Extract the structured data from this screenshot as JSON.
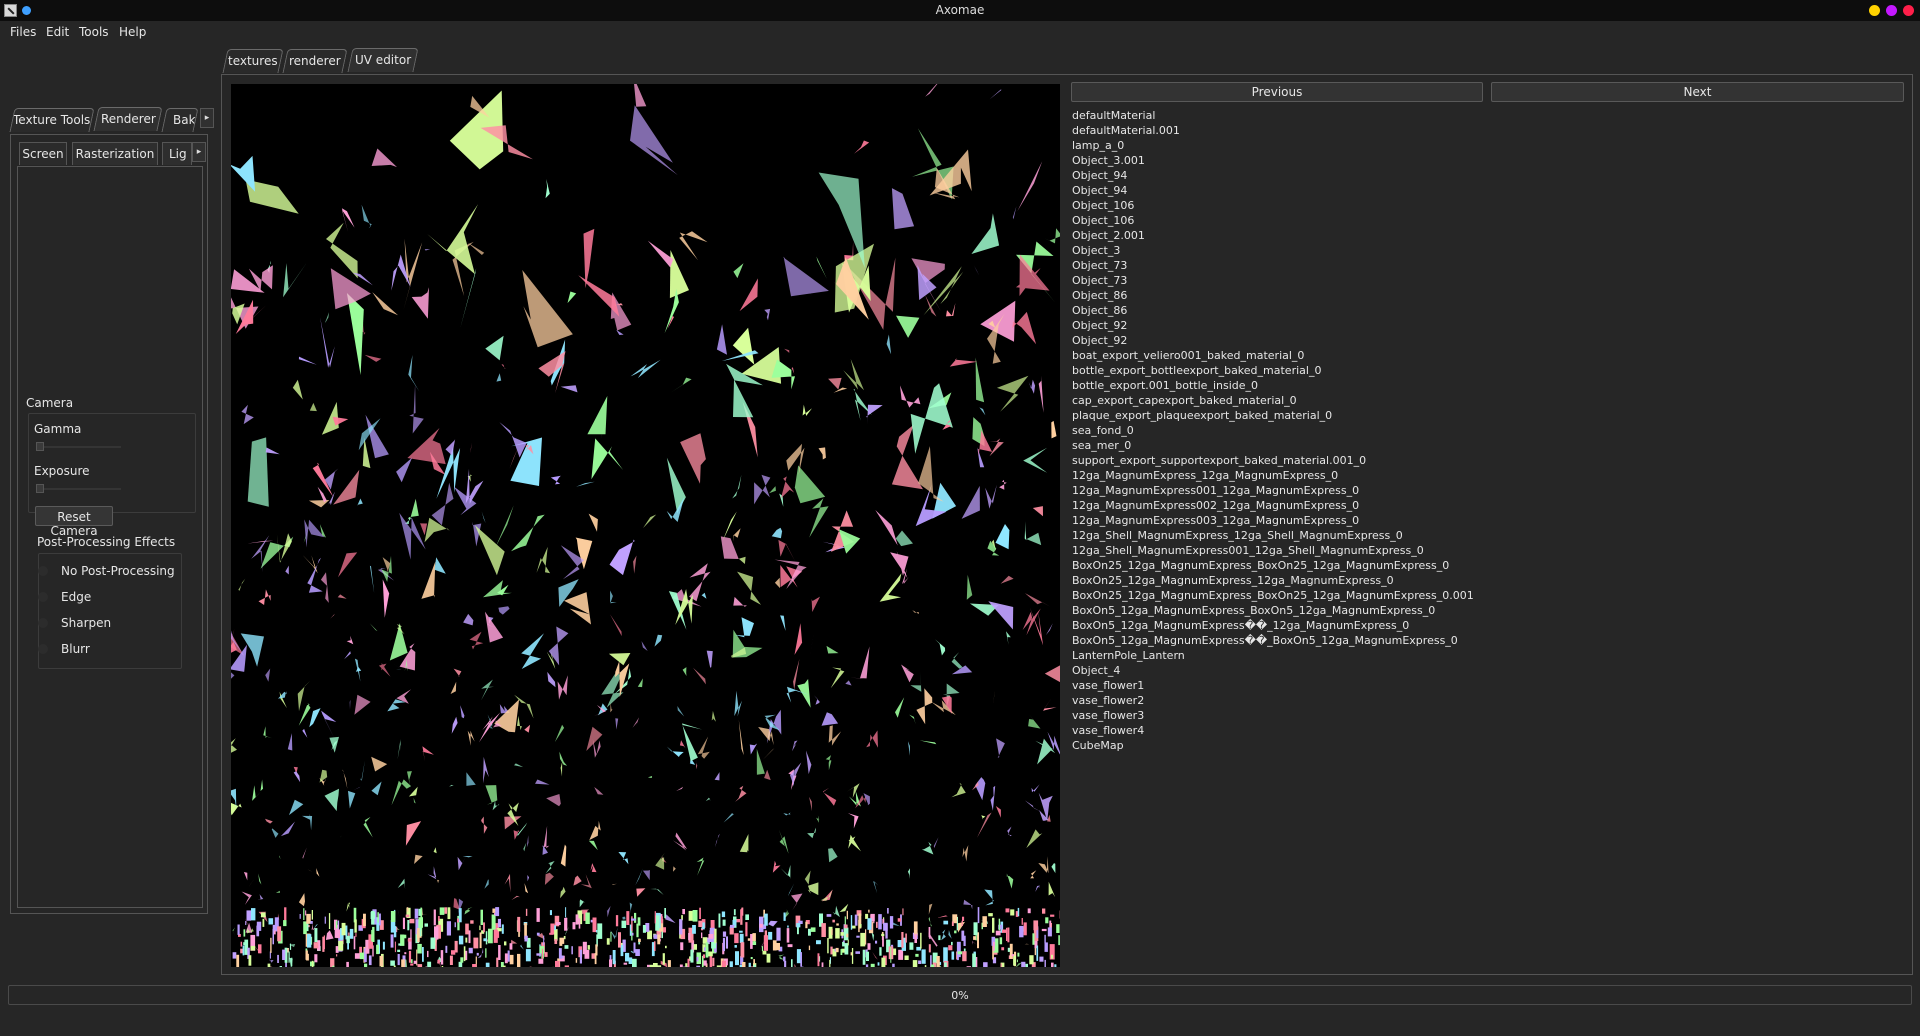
{
  "window": {
    "title": "Axomae",
    "buttons": [
      {
        "name": "minimize",
        "color": "#ffd200"
      },
      {
        "name": "maximize",
        "color": "#c418ff"
      },
      {
        "name": "close",
        "color": "#ff1f4a"
      }
    ]
  },
  "menu": [
    "Files",
    "Edit",
    "Tools",
    "Help"
  ],
  "left_dock": {
    "tabs": [
      "Texture Tools",
      "Renderer",
      "Bak"
    ],
    "active_tab": "Renderer",
    "subtabs": [
      "Screen",
      "Rasterization",
      "Lig"
    ],
    "active_subtab": "Screen",
    "camera": {
      "title": "Camera",
      "gamma_label": "Gamma",
      "gamma_value": 0,
      "exposure_label": "Exposure",
      "exposure_value": 0,
      "reset_label": "Reset Camera"
    },
    "post_processing": {
      "title": "Post-Processing Effects",
      "options": [
        "No Post-Processing",
        "Edge",
        "Sharpen",
        "Blurr"
      ]
    }
  },
  "center_tabs": [
    "textures",
    "renderer",
    "UV editor"
  ],
  "active_center_tab": "UV editor",
  "uv_editor": {
    "previous_label": "Previous",
    "next_label": "Next",
    "meshes": [
      "defaultMaterial",
      "defaultMaterial.001",
      "lamp_a_0",
      "Object_3.001",
      "Object_94",
      "Object_94",
      "Object_106",
      "Object_106",
      "Object_2.001",
      "Object_3",
      "Object_73",
      "Object_73",
      "Object_86",
      "Object_86",
      "Object_92",
      "Object_92",
      "boat_export_veliero001_baked_material_0",
      "bottle_export_bottleexport_baked_material_0",
      "bottle_export.001_bottle_inside_0",
      "cap_export_capexport_baked_material_0",
      "plaque_export_plaqueexport_baked_material_0",
      "sea_fond_0",
      "sea_mer_0",
      "support_export_supportexport_baked_material.001_0",
      "12ga_MagnumExpress_12ga_MagnumExpress_0",
      "12ga_MagnumExpress001_12ga_MagnumExpress_0",
      "12ga_MagnumExpress002_12ga_MagnumExpress_0",
      "12ga_MagnumExpress003_12ga_MagnumExpress_0",
      "12ga_Shell_MagnumExpress_12ga_Shell_MagnumExpress_0",
      "12ga_Shell_MagnumExpress001_12ga_Shell_MagnumExpress_0",
      "BoxOn25_12ga_MagnumExpress_BoxOn25_12ga_MagnumExpress_0",
      "BoxOn25_12ga_MagnumExpress_12ga_MagnumExpress_0",
      "BoxOn25_12ga_MagnumExpress_BoxOn25_12ga_MagnumExpress_0.001",
      "BoxOn5_12ga_MagnumExpress_BoxOn5_12ga_MagnumExpress_0",
      "BoxOn5_12ga_MagnumExpress��_12ga_MagnumExpress_0",
      "BoxOn5_12ga_MagnumExpress��_BoxOn5_12ga_MagnumExpress_0",
      "LanternPole_Lantern",
      "Object_4",
      "vase_flower1",
      "vase_flower2",
      "vase_flower3",
      "vase_flower4",
      "CubeMap"
    ]
  },
  "progress": {
    "value": 0,
    "label": "0%"
  }
}
